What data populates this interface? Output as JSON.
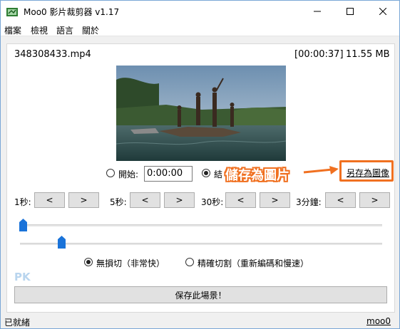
{
  "window": {
    "title": "Moo0 影片裁剪器 v1.17"
  },
  "menu": [
    "檔案",
    "檢視",
    "語言",
    "關於"
  ],
  "file": {
    "name": "348308433.mp4",
    "duration": "[00:00:37]",
    "size": "11.55 MB"
  },
  "start": {
    "label": "開始:",
    "value": "0:00:00"
  },
  "end": {
    "label_partial": "結"
  },
  "save_image_link": "另存為圖像",
  "annotation": "儲存為圖片",
  "steps": [
    {
      "label": "1秒:",
      "back": "<",
      "fwd": ">"
    },
    {
      "label": "5秒:",
      "back": "<",
      "fwd": ">"
    },
    {
      "label": "30秒:",
      "back": "<",
      "fwd": ">"
    },
    {
      "label": "3分鐘:",
      "back": "<",
      "fwd": ">"
    }
  ],
  "modes": {
    "lossless": "無損切（非常快）",
    "precise": "精確切割（重新編碼和慢速）"
  },
  "save_scene_button": "保存此場景！",
  "watermark": "PK",
  "status": {
    "text": "已就緒",
    "link": "moo0"
  },
  "colors": {
    "accent": "#f07020",
    "slider_thumb": "#1a73d9"
  }
}
